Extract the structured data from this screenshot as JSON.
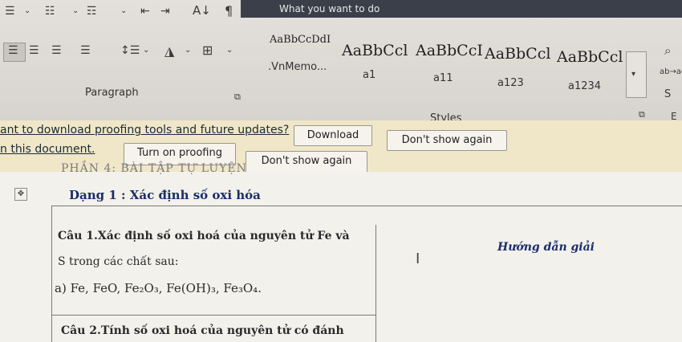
{
  "tellme": {
    "text": "What you want to do"
  },
  "paragraph": {
    "label": "Paragraph"
  },
  "styles": {
    "label": "Styles",
    "items": [
      {
        "preview": "AaBbCcDdI",
        "name": ".VnMemo..."
      },
      {
        "preview": "AaBbCcl",
        "name": "a1"
      },
      {
        "preview": "AaBbCcI",
        "name": "a11"
      },
      {
        "preview": "AaBbCcl",
        "name": "a123"
      },
      {
        "preview": "AaBbCcl",
        "name": "a1234"
      }
    ]
  },
  "editing": {
    "replace_label": "ab→ac",
    "select_label": "S",
    "extra": "E"
  },
  "message": {
    "line1": "ant to download proofing tools and future updates?",
    "download": "Download",
    "dont_show": "Don't show again",
    "line2": "n this document.",
    "turn_on": "Turn on proofing",
    "dont_show2": "Don't show again"
  },
  "document": {
    "cut_heading": "PHẦN 4: BÀI TẬP TỰ LUYỆN",
    "heading": "Dạng 1 : Xác định số oxi hóa",
    "q1_line1": "Câu 1.Xác định số oxi hoá của nguyên tử Fe và",
    "q1_line2": "S trong các chất sau:",
    "q1_line3": "a) Fe, FeO, Fe₂O₃, Fe(OH)₃, Fe₃O₄.",
    "answer_header": "Hướng dẫn giải",
    "q2_line1": "Câu 2.Tính số oxi hoá của nguyên tử có đánh"
  }
}
